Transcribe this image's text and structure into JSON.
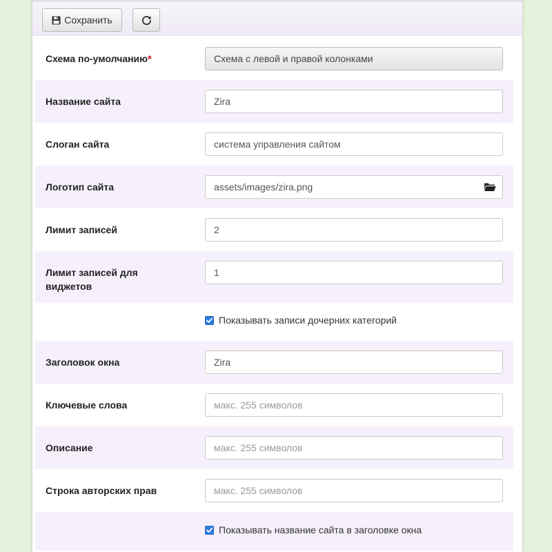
{
  "toolbar": {
    "save_label": "Сохранить",
    "save_icon": "floppy-disk-icon",
    "refresh_icon": "refresh-icon"
  },
  "form": {
    "default_layout": {
      "label": "Схема по-умолчанию",
      "required_mark": "*",
      "value": "Схема с левой и правой колонками"
    },
    "site_name": {
      "label": "Название сайта",
      "value": "Zira"
    },
    "site_slogan": {
      "label": "Слоган сайта",
      "value": "система управления сайтом"
    },
    "site_logo": {
      "label": "Логотип сайта",
      "value": "assets/images/zira.png",
      "icon": "folder-open-icon"
    },
    "records_limit": {
      "label": "Лимит записей",
      "value": "2"
    },
    "widget_records_limit": {
      "label_line1": "Лимит записей для",
      "label_line2": "виджетов",
      "value": "1"
    },
    "show_child_category_records": {
      "label": "Показывать записи дочерних категорий",
      "checked": true
    },
    "window_title": {
      "label": "Заголовок окна",
      "value": "Zira"
    },
    "keywords": {
      "label": "Ключевые слова",
      "placeholder": "макс. 255 символов",
      "value": ""
    },
    "description": {
      "label": "Описание",
      "placeholder": "макс. 255 символов",
      "value": ""
    },
    "copyright": {
      "label": "Строка авторских прав",
      "placeholder": "макс. 255 символов",
      "value": ""
    },
    "show_site_name_in_title": {
      "label": "Показывать название сайта в заголовке окна",
      "checked": true
    }
  },
  "colors": {
    "background": "#e4f3dc",
    "row_alt": "#f5f0fb",
    "checkbox": "#2f7de1",
    "required": "#d0021b"
  }
}
